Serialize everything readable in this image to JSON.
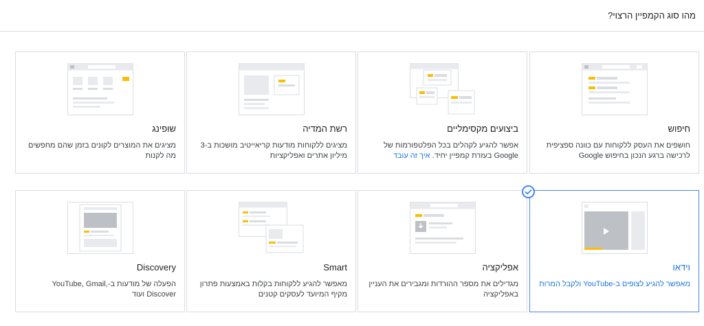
{
  "header": {
    "title": "מהו סוג הקמפיין הרצוי?"
  },
  "cards": {
    "search": {
      "title": "חיפוש",
      "desc": "חושפים את העסק ללקוחות עם כוונה ספציפית לרכישה ברגע הנכון בחיפוש Google"
    },
    "pmax": {
      "title": "ביצועים מקסימליים",
      "desc": "אפשר להגיע לקהלים בכל הפלטפורמות של Google בעזרת קמפיין יחיד.",
      "link": "איך זה עובד"
    },
    "display": {
      "title": "רשת המדיה",
      "desc": "מציגים ללקוחות מודעות קריאייטיב מושכות ב-3 מיליון אתרים ואפליקציות"
    },
    "shopping": {
      "title": "שופינג",
      "desc": "מציגים את המוצרים לקונים בזמן שהם מחפשים מה לקנות"
    },
    "video": {
      "title": "וידאו",
      "desc": "מאפשר להגיע לצופים ב-YouTube ולקבל המרות"
    },
    "app": {
      "title": "אפליקציה",
      "desc": "מגדילים את מספר ההורדות ומגבירים את העניין באפליקציה"
    },
    "smart": {
      "title": "Smart",
      "desc": "מאפשר להגיע ללקוחות בקלות באמצעות פתרון מקיף המיועד לעסקים קטנים"
    },
    "discovery": {
      "title": "Discovery",
      "desc": "הפעלה של מודעות ב-YouTube, Gmail, Discover ועוד"
    }
  },
  "colors": {
    "accent_yellow": "#fbbc04",
    "selected_blue": "#1a73e8",
    "border": "#dadce0",
    "thumb_gray": "#e8eaed"
  },
  "icons": {
    "selected": "check-circle-icon"
  }
}
